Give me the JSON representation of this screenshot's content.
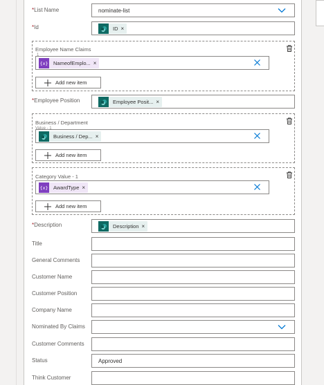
{
  "fields": {
    "list_name": {
      "label": "List Name",
      "value": "nominate-list"
    },
    "id": {
      "label": "Id",
      "token": "ID"
    },
    "employee_position": {
      "label": "Employee Position",
      "token": "Employee Posit..."
    },
    "description": {
      "label": "Description",
      "token": "Description"
    },
    "title": {
      "label": "Title",
      "value": ""
    },
    "general_comments": {
      "label": "General Comments",
      "value": ""
    },
    "customer_name": {
      "label": "Customer Name",
      "value": ""
    },
    "customer_position": {
      "label": "Customer Position",
      "value": ""
    },
    "company_name": {
      "label": "Company Name",
      "value": ""
    },
    "nominated_by_claims": {
      "label": "Nominated By Claims",
      "value": ""
    },
    "customer_comments": {
      "label": "Customer Comments",
      "value": ""
    },
    "status": {
      "label": "Status",
      "value": "Approved"
    },
    "think_customer": {
      "label": "Think Customer",
      "value": ""
    }
  },
  "groups": {
    "employee_name_claims": {
      "label": "Employee Name Claims",
      "label_sub": "1",
      "token": "NameofEmplo..."
    },
    "business_department": {
      "label": "Business / Department",
      "label_sub": "Value - 1",
      "token": "Business / Dep..."
    },
    "category_value": {
      "label": "Category Value - 1",
      "token": "AwardType"
    }
  },
  "common": {
    "required_mark": "*",
    "add_new_item": "Add new item",
    "remove_glyph": "×",
    "expr_glyph": "{x}"
  },
  "icons": {
    "dropdown": "chevron-down-icon",
    "sharepoint": "sharepoint-icon",
    "expression": "expression-icon",
    "delete": "trash-icon",
    "clear": "close-icon",
    "add": "plus-icon"
  },
  "colors": {
    "accent": "#0078d4",
    "sharepoint_teal": "#0f6a63",
    "expression_purple": "#7f3fbf",
    "required": "#a4262c"
  }
}
